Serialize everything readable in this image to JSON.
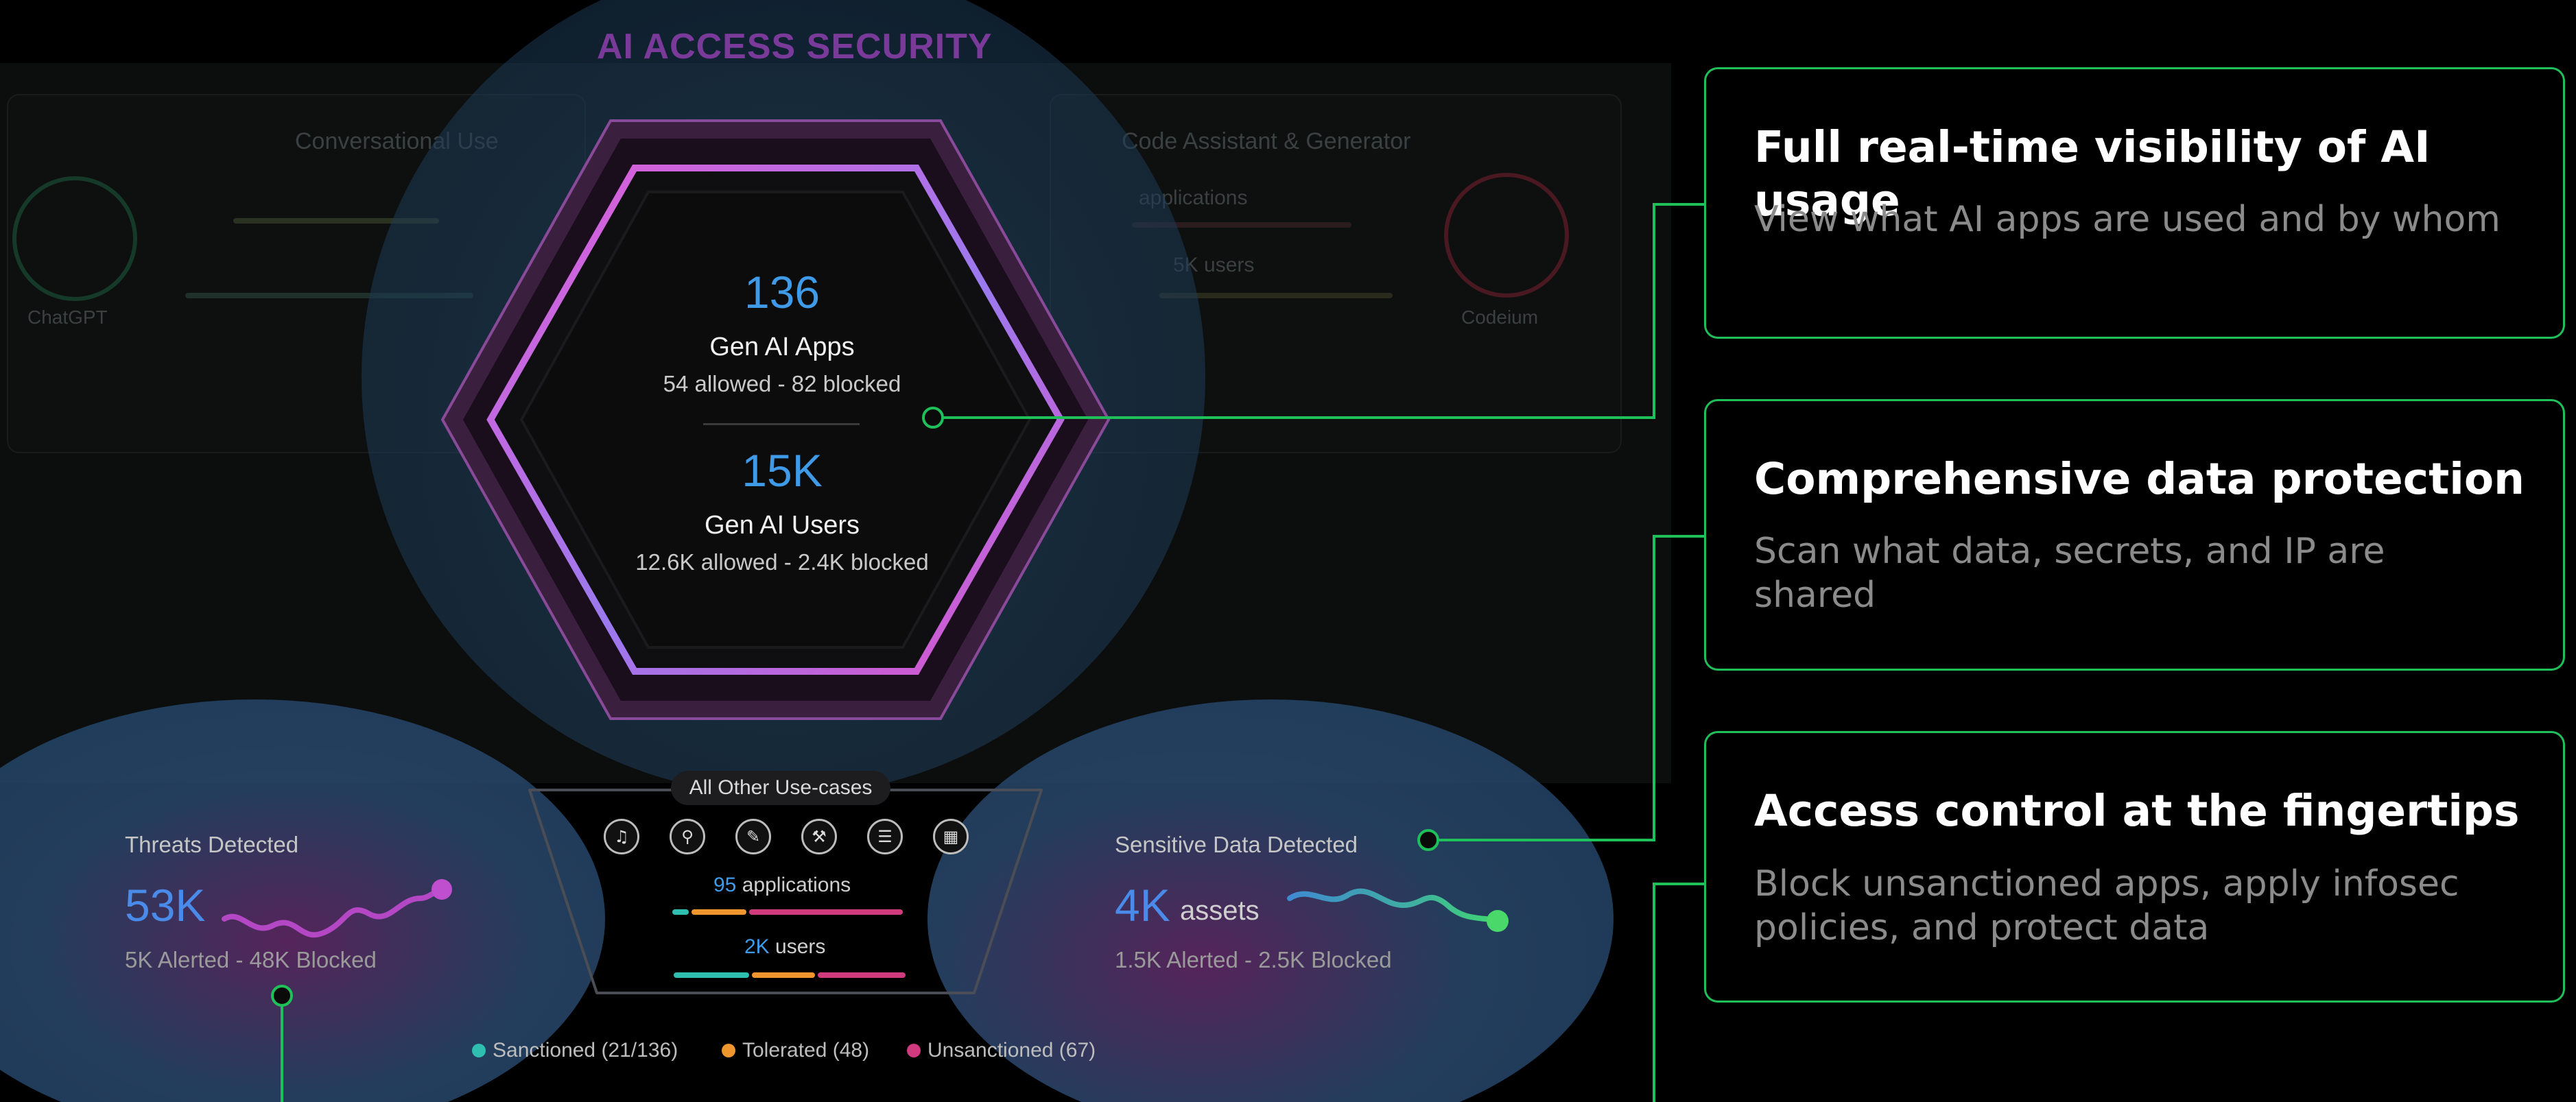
{
  "title": "AI ACCESS SECURITY",
  "background_dashboard": {
    "left_card_title": "Conversational Use",
    "left_app": "ChatGPT",
    "right_card_title": "Code Assistant & Generator",
    "right_app": "Codeium",
    "right_apps_label": "applications",
    "right_users_label": "5K users"
  },
  "hexagon": {
    "apps_count": "136",
    "apps_label": "Gen AI Apps",
    "apps_sub": "54 allowed - 82 blocked",
    "users_count": "15K",
    "users_label": "Gen AI Users",
    "users_sub": "12.6K allowed - 2.4K blocked"
  },
  "threats": {
    "title": "Threats Detected",
    "value": "53K",
    "sub": "5K Alerted - 48K Blocked"
  },
  "sensitive": {
    "title": "Sensitive Data Detected",
    "value": "4K",
    "unit": "assets",
    "sub": "1.5K Alerted - 2.5K Blocked"
  },
  "other_use_cases": {
    "label": "All Other Use-cases",
    "icons": [
      "music-icon",
      "search-icon",
      "pen-icon",
      "tools-icon",
      "list-icon",
      "calendar-icon"
    ],
    "apps_count": "95",
    "apps_label": "applications",
    "users_count": "2K",
    "users_label": "users"
  },
  "legend": [
    {
      "label": "Sanctioned (21/136)",
      "color": "#2fbfb0"
    },
    {
      "label": "Tolerated (48)",
      "color": "#f0962e"
    },
    {
      "label": "Unsanctioned (67)",
      "color": "#d23a7e"
    }
  ],
  "cards": [
    {
      "title": "Full real-time visibility of AI usage",
      "body": "View what AI apps are used and by whom"
    },
    {
      "title": "Comprehensive data protection",
      "body": "Scan what data, secrets, and IP are shared"
    },
    {
      "title": "Access control at the fingertips",
      "body": "Block unsanctioned apps, apply infosec policies, and protect data"
    }
  ],
  "colors": {
    "accent_green": "#1fbf59",
    "number_blue": "#3f9ae8",
    "title_purple": "#7a3a9a"
  }
}
